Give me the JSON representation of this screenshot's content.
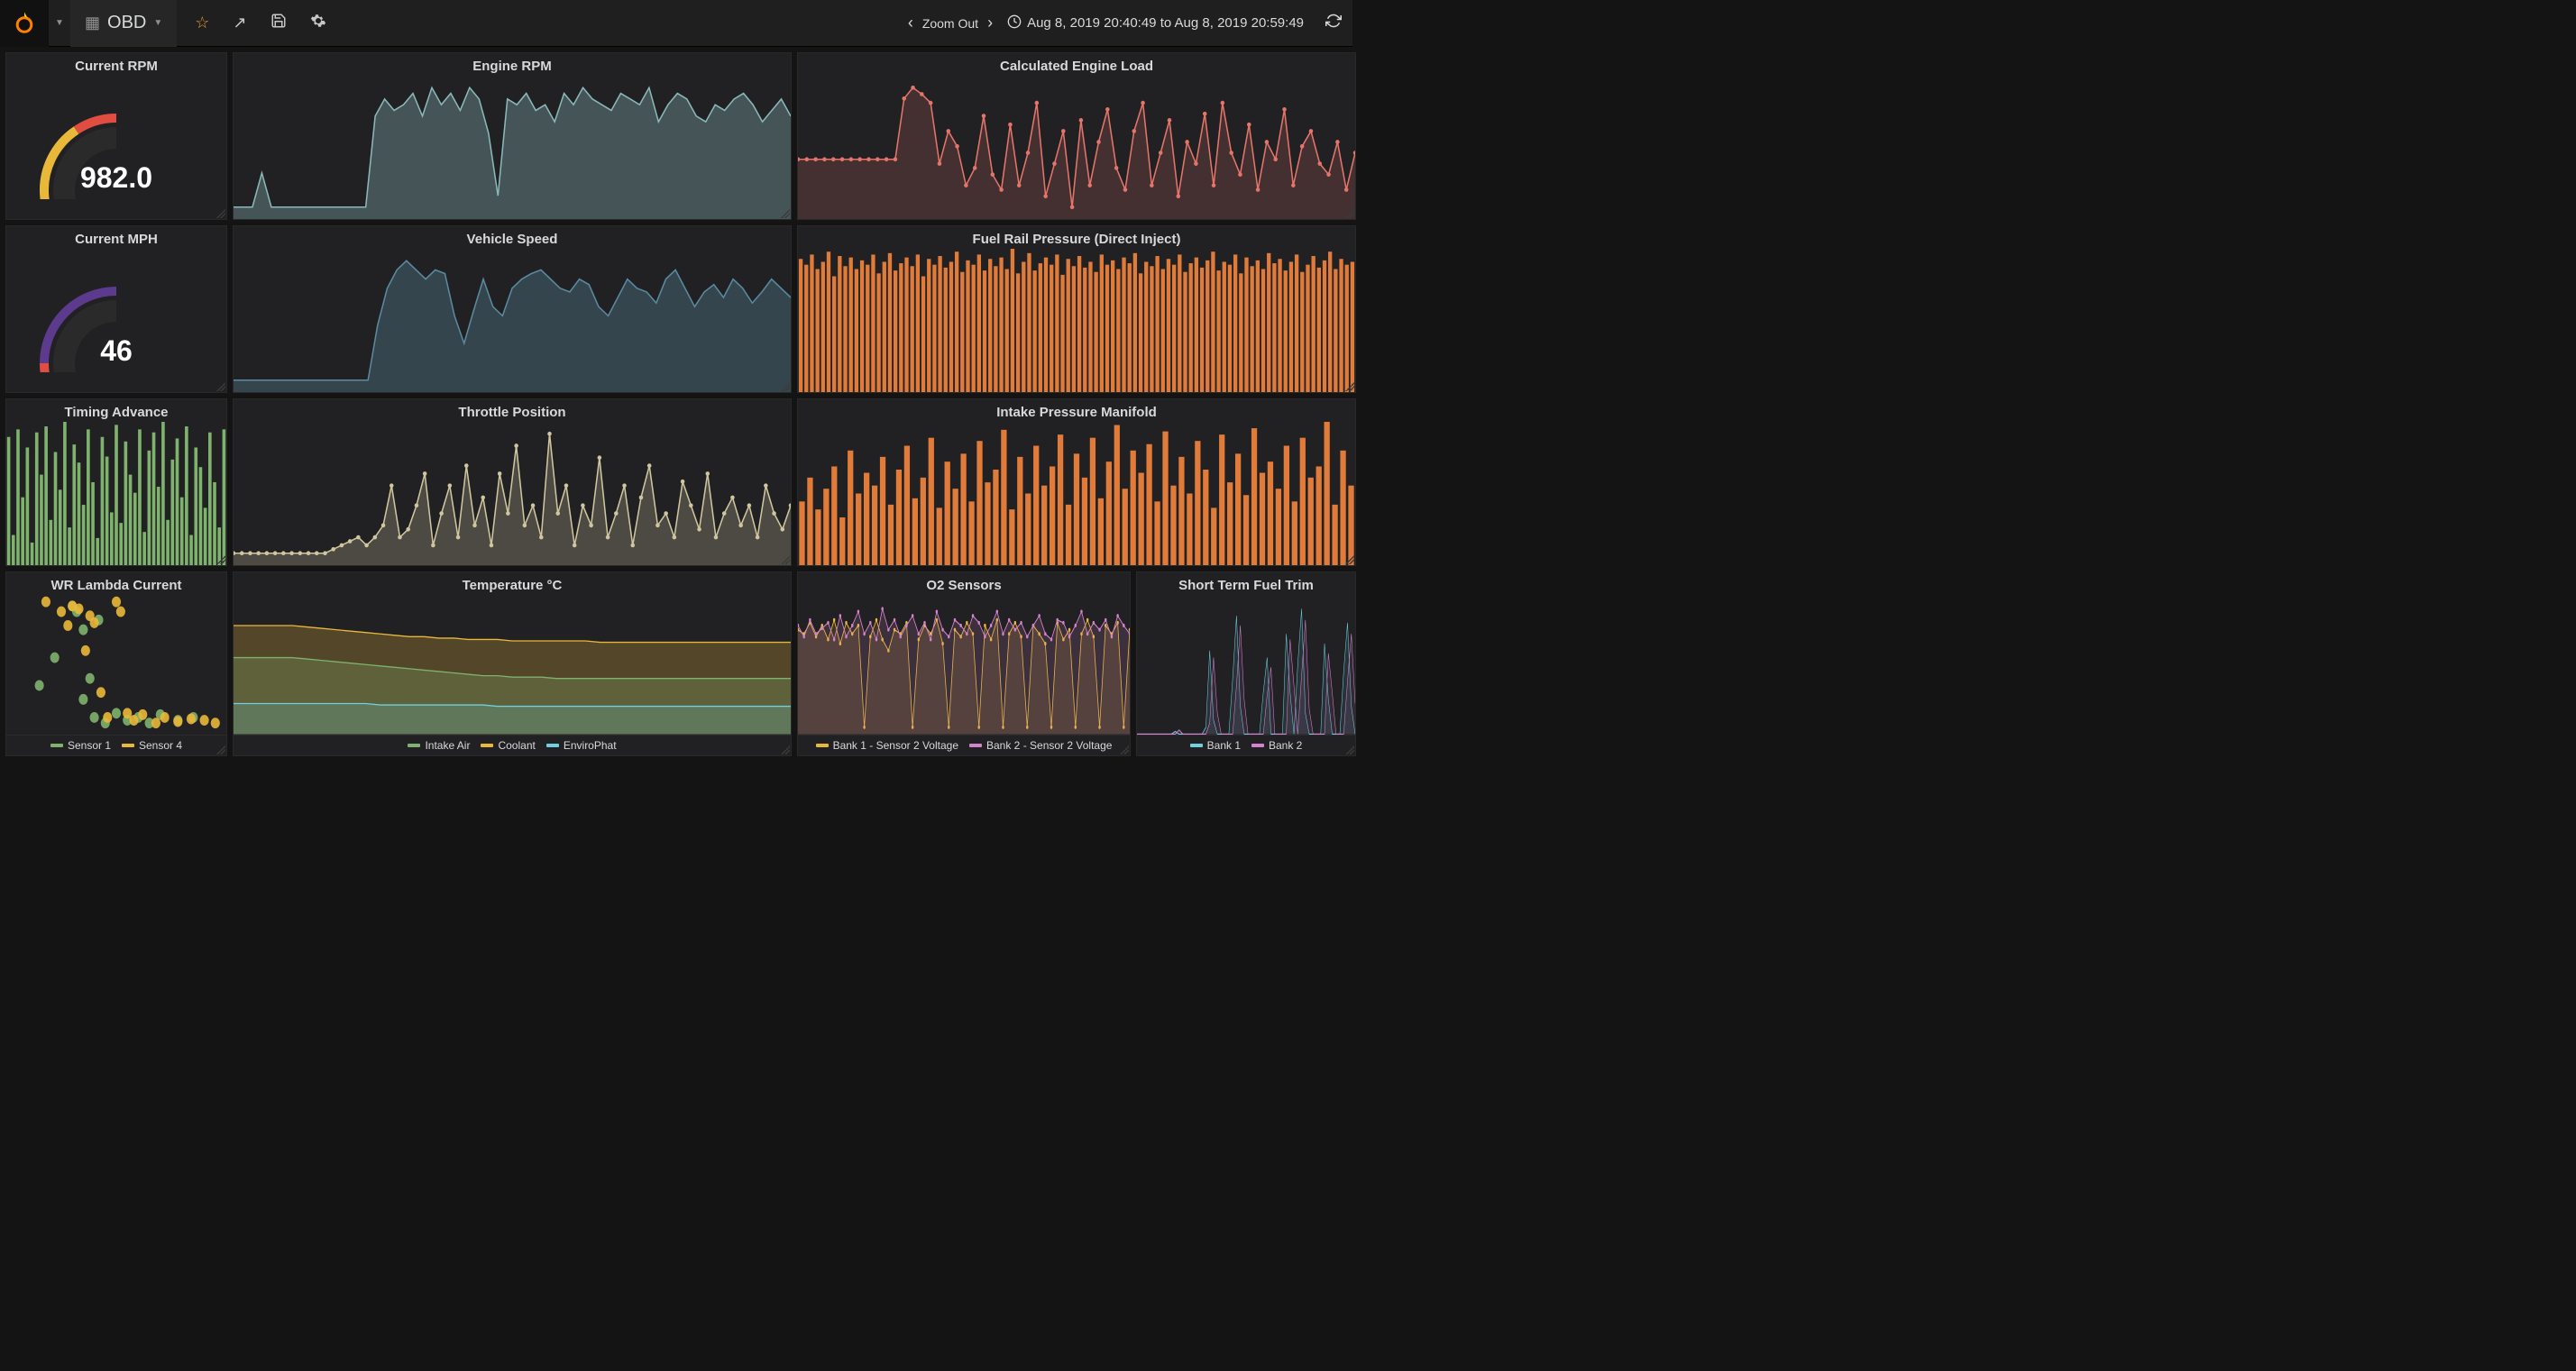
{
  "nav": {
    "dashboard_title": "OBD",
    "zoom_label": "Zoom Out",
    "timerange": "Aug 8, 2019 20:40:49 to Aug 8, 2019 20:59:49"
  },
  "panels": {
    "current_rpm": {
      "title": "Current RPM",
      "value": "982.0"
    },
    "current_mph": {
      "title": "Current MPH",
      "value": "46"
    },
    "engine_rpm": {
      "title": "Engine RPM"
    },
    "engine_load": {
      "title": "Calculated Engine Load"
    },
    "vehicle_speed": {
      "title": "Vehicle Speed"
    },
    "fuel_rail": {
      "title": "Fuel Rail Pressure (Direct Inject)"
    },
    "timing_advance": {
      "title": "Timing Advance"
    },
    "throttle": {
      "title": "Throttle Position"
    },
    "intake_manifold": {
      "title": "Intake Pressure Manifold"
    },
    "lambda": {
      "title": "WR Lambda Current",
      "legend": [
        {
          "label": "Sensor 1",
          "color": "#7eb26d"
        },
        {
          "label": "Sensor 4",
          "color": "#eab839"
        }
      ]
    },
    "temperature": {
      "title": "Temperature °C",
      "legend": [
        {
          "label": "Intake Air",
          "color": "#7eb26d"
        },
        {
          "label": "Coolant",
          "color": "#eab839"
        },
        {
          "label": "EnviroPhat",
          "color": "#6ed0e0"
        }
      ]
    },
    "o2": {
      "title": "O2 Sensors",
      "legend": [
        {
          "label": "Bank 1 - Sensor 2 Voltage",
          "color": "#eab839"
        },
        {
          "label": "Bank 2 - Sensor 2 Voltage",
          "color": "#d683ce"
        }
      ]
    },
    "fuel_trim": {
      "title": "Short Term Fuel Trim",
      "legend": [
        {
          "label": "Bank 1",
          "color": "#6ed0e0"
        },
        {
          "label": "Bank 2",
          "color": "#d683ce"
        }
      ]
    }
  },
  "colors": {
    "teal": "#8ab8b8",
    "green": "#7eb26d",
    "yellow": "#eab839",
    "orange": "#e07b3a",
    "red": "#e24d42",
    "salmon": "#e5756a",
    "steel": "#5a8a9e",
    "tan": "#cfc69f",
    "purple": "#d683ce",
    "cyan": "#6ed0e0"
  },
  "chart_data": [
    {
      "panel": "current_rpm",
      "type": "gauge",
      "value": 982.0,
      "min": 0,
      "max": 8000,
      "thresholds": [
        [
          0,
          "#e24d42"
        ],
        [
          1000,
          "#eab839"
        ],
        [
          6500,
          "#e24d42"
        ]
      ]
    },
    {
      "panel": "current_mph",
      "type": "gauge",
      "value": 46,
      "min": 0,
      "max": 120,
      "thresholds": [
        [
          0,
          "#e24d42"
        ],
        [
          60,
          "#5c3a8e"
        ]
      ]
    },
    {
      "panel": "engine_rpm",
      "type": "area",
      "color": "#8ab8b8",
      "values": [
        800,
        800,
        800,
        1400,
        800,
        800,
        800,
        800,
        800,
        800,
        800,
        800,
        800,
        800,
        800,
        2400,
        2700,
        2500,
        2600,
        2800,
        2400,
        2900,
        2600,
        2800,
        2500,
        2900,
        2700,
        2100,
        1000,
        2700,
        2600,
        2800,
        2500,
        2600,
        2300,
        2800,
        2600,
        2900,
        2700,
        2600,
        2500,
        2800,
        2700,
        2600,
        2900,
        2300,
        2600,
        2800,
        2700,
        2400,
        2300,
        2600,
        2500,
        2700,
        2800,
        2600,
        2300,
        2500,
        2700,
        2400
      ]
    },
    {
      "panel": "engine_load",
      "type": "line",
      "color": "#e5756a",
      "points": true,
      "fill": 0.18,
      "values": [
        42,
        42,
        42,
        42,
        42,
        42,
        42,
        42,
        42,
        42,
        42,
        42,
        70,
        75,
        72,
        68,
        40,
        55,
        48,
        30,
        38,
        62,
        35,
        28,
        58,
        30,
        45,
        68,
        25,
        40,
        55,
        20,
        60,
        30,
        50,
        65,
        38,
        28,
        55,
        68,
        30,
        45,
        60,
        25,
        50,
        40,
        63,
        30,
        68,
        45,
        35,
        58,
        28,
        50,
        42,
        65,
        30,
        48,
        55,
        40,
        35,
        50,
        28,
        45
      ]
    },
    {
      "panel": "vehicle_speed",
      "type": "area",
      "color": "#5a8a9e",
      "values": [
        0,
        0,
        0,
        0,
        0,
        0,
        0,
        0,
        0,
        0,
        0,
        0,
        0,
        0,
        0,
        30,
        50,
        60,
        65,
        60,
        55,
        60,
        58,
        35,
        20,
        38,
        55,
        40,
        35,
        50,
        55,
        58,
        60,
        55,
        50,
        48,
        55,
        52,
        40,
        35,
        45,
        55,
        50,
        48,
        42,
        55,
        60,
        50,
        40,
        48,
        52,
        45,
        55,
        50,
        42,
        48,
        55,
        50,
        45
      ]
    },
    {
      "panel": "fuel_rail",
      "type": "bar",
      "color": "#e07b3a",
      "values": [
        92,
        88,
        95,
        85,
        90,
        97,
        80,
        94,
        87,
        93,
        85,
        91,
        88,
        95,
        82,
        90,
        96,
        84,
        89,
        93,
        87,
        95,
        80,
        92,
        88,
        94,
        86,
        90,
        97,
        83,
        91,
        88,
        95,
        84,
        92,
        87,
        93,
        85,
        99,
        82,
        90,
        96,
        84,
        89,
        93,
        88,
        95,
        81,
        92,
        87,
        94,
        86,
        90,
        83,
        95,
        88,
        91,
        85,
        93,
        89,
        96,
        82,
        90,
        87,
        94,
        85,
        92,
        88,
        95,
        83,
        89,
        93,
        86,
        91,
        97,
        84,
        90,
        88,
        95,
        82,
        93,
        87,
        91,
        85,
        96,
        89,
        92,
        84,
        90,
        95,
        83,
        88,
        94,
        86,
        91,
        97,
        85,
        92,
        88,
        90
      ]
    },
    {
      "panel": "timing_advance",
      "type": "bar",
      "color": "#7eb26d",
      "values": [
        85,
        20,
        90,
        45,
        78,
        15,
        88,
        60,
        92,
        30,
        75,
        50,
        95,
        25,
        80,
        68,
        40,
        90,
        55,
        18,
        85,
        72,
        35,
        93,
        28,
        82,
        60,
        48,
        90,
        22,
        76,
        88,
        52,
        95,
        30,
        70,
        84,
        45,
        92,
        20,
        78,
        65,
        38,
        88,
        55,
        25,
        90
      ]
    },
    {
      "panel": "throttle",
      "type": "line",
      "color": "#cfc69f",
      "points": true,
      "fill": 0.25,
      "values": [
        18,
        18,
        18,
        18,
        18,
        18,
        18,
        18,
        18,
        18,
        18,
        18,
        19,
        20,
        21,
        22,
        20,
        22,
        25,
        35,
        22,
        24,
        30,
        38,
        20,
        28,
        35,
        22,
        40,
        25,
        32,
        20,
        38,
        28,
        45,
        25,
        30,
        22,
        48,
        28,
        35,
        20,
        30,
        25,
        42,
        22,
        28,
        35,
        20,
        32,
        40,
        25,
        28,
        22,
        36,
        30,
        24,
        38,
        22,
        28,
        32,
        25,
        30,
        22,
        35,
        28,
        24,
        30
      ]
    },
    {
      "panel": "intake_manifold",
      "type": "bar",
      "color": "#e07b3a",
      "values": [
        40,
        55,
        35,
        48,
        62,
        30,
        72,
        45,
        58,
        50,
        68,
        38,
        60,
        75,
        42,
        55,
        80,
        36,
        65,
        48,
        70,
        40,
        78,
        52,
        60,
        85,
        35,
        68,
        45,
        75,
        50,
        62,
        82,
        38,
        70,
        55,
        80,
        42,
        65,
        88,
        48,
        72,
        58,
        76,
        40,
        84,
        50,
        68,
        45,
        78,
        60,
        36,
        82,
        52,
        70,
        44,
        86,
        58,
        65,
        48,
        75,
        40,
        80,
        55,
        62,
        90,
        38,
        72,
        50
      ]
    },
    {
      "panel": "lambda",
      "type": "scatter",
      "series": [
        {
          "name": "Sensor 1",
          "color": "#7eb26d",
          "points": [
            [
              0.15,
              0.35
            ],
            [
              0.22,
              0.55
            ],
            [
              0.3,
              0.92
            ],
            [
              0.32,
              0.88
            ],
            [
              0.35,
              0.25
            ],
            [
              0.35,
              0.75
            ],
            [
              0.38,
              0.4
            ],
            [
              0.4,
              0.12
            ],
            [
              0.42,
              0.82
            ],
            [
              0.45,
              0.08
            ],
            [
              0.5,
              0.15
            ],
            [
              0.55,
              0.1
            ],
            [
              0.6,
              0.12
            ],
            [
              0.65,
              0.08
            ],
            [
              0.7,
              0.14
            ],
            [
              0.78,
              0.1
            ],
            [
              0.85,
              0.12
            ]
          ]
        },
        {
          "name": "Sensor 4",
          "color": "#eab839",
          "points": [
            [
              0.18,
              0.95
            ],
            [
              0.25,
              0.88
            ],
            [
              0.28,
              0.78
            ],
            [
              0.3,
              0.92
            ],
            [
              0.33,
              0.9
            ],
            [
              0.36,
              0.6
            ],
            [
              0.38,
              0.85
            ],
            [
              0.4,
              0.8
            ],
            [
              0.43,
              0.3
            ],
            [
              0.46,
              0.12
            ],
            [
              0.5,
              0.95
            ],
            [
              0.52,
              0.88
            ],
            [
              0.55,
              0.15
            ],
            [
              0.58,
              0.1
            ],
            [
              0.62,
              0.14
            ],
            [
              0.68,
              0.08
            ],
            [
              0.72,
              0.12
            ],
            [
              0.78,
              0.09
            ],
            [
              0.84,
              0.11
            ],
            [
              0.9,
              0.1
            ],
            [
              0.95,
              0.08
            ]
          ]
        }
      ]
    },
    {
      "panel": "temperature",
      "type": "area",
      "series": [
        {
          "name": "Coolant",
          "color": "#eab839",
          "fill": 0.25,
          "values": [
            78,
            78,
            78,
            78,
            78,
            77,
            76,
            75,
            74,
            73,
            72,
            71,
            70,
            70,
            69,
            69,
            68,
            68,
            68,
            67,
            67,
            67,
            67,
            67,
            67,
            66,
            66,
            66,
            66,
            66,
            66,
            66,
            66,
            66,
            66,
            66,
            66,
            66,
            66
          ]
        },
        {
          "name": "Intake Air",
          "color": "#7eb26d",
          "fill": 0.25,
          "values": [
            55,
            55,
            55,
            55,
            55,
            54,
            53,
            52,
            51,
            50,
            49,
            48,
            47,
            46,
            45,
            44,
            43,
            42,
            42,
            41,
            41,
            41,
            40,
            40,
            40,
            40,
            40,
            40,
            40,
            40,
            40,
            40,
            40,
            40,
            40,
            40,
            40,
            40,
            40
          ]
        },
        {
          "name": "EnviroPhat",
          "color": "#6ed0e0",
          "fill": 0.2,
          "values": [
            22,
            22,
            22,
            22,
            22,
            22,
            22,
            22,
            22,
            22,
            21,
            21,
            21,
            21,
            21,
            21,
            21,
            21,
            20,
            20,
            20,
            20,
            20,
            20,
            20,
            20,
            20,
            20,
            20,
            20,
            20,
            20,
            20,
            20,
            20,
            20,
            20,
            20,
            20
          ]
        }
      ],
      "ylim": [
        0,
        100
      ]
    },
    {
      "panel": "o2",
      "type": "line",
      "points": true,
      "fill": 0.15,
      "series": [
        {
          "name": "Bank 1 - Sensor 2 Voltage",
          "color": "#eab839",
          "values": [
            0.75,
            0.72,
            0.8,
            0.7,
            0.78,
            0.68,
            0.82,
            0.65,
            0.8,
            0.72,
            0.78,
            0.05,
            0.7,
            0.82,
            0.68,
            0.6,
            0.75,
            0.72,
            0.8,
            0.05,
            0.68,
            0.78,
            0.72,
            0.82,
            0.65,
            0.05,
            0.75,
            0.7,
            0.8,
            0.72,
            0.05,
            0.78,
            0.68,
            0.82,
            0.05,
            0.72,
            0.8,
            0.7,
            0.05,
            0.78,
            0.72,
            0.65,
            0.05,
            0.8,
            0.68,
            0.75,
            0.05,
            0.72,
            0.82,
            0.7,
            0.05,
            0.78,
            0.72,
            0.8,
            0.05,
            0.75
          ]
        },
        {
          "name": "Bank 2 - Sensor 2 Voltage",
          "color": "#d683ce",
          "values": [
            0.78,
            0.7,
            0.82,
            0.72,
            0.76,
            0.8,
            0.68,
            0.85,
            0.7,
            0.78,
            0.88,
            0.72,
            0.8,
            0.68,
            0.9,
            0.75,
            0.82,
            0.7,
            0.78,
            0.85,
            0.72,
            0.8,
            0.68,
            0.88,
            0.75,
            0.7,
            0.82,
            0.78,
            0.72,
            0.85,
            0.8,
            0.7,
            0.78,
            0.88,
            0.72,
            0.82,
            0.75,
            0.8,
            0.7,
            0.78,
            0.85,
            0.72,
            0.68,
            0.82,
            0.8,
            0.7,
            0.78,
            0.88,
            0.72,
            0.8,
            0.75,
            0.82,
            0.7,
            0.85,
            0.78,
            0.72
          ]
        }
      ],
      "ylim": [
        0,
        1
      ]
    },
    {
      "panel": "fuel_trim",
      "type": "line",
      "fill": 0.1,
      "series": [
        {
          "name": "Bank 1",
          "color": "#6ed0e0",
          "values": [
            0,
            0,
            0,
            0,
            0,
            0,
            0,
            0,
            0,
            0,
            2,
            0,
            0,
            0,
            0,
            0,
            0,
            0,
            5,
            60,
            10,
            0,
            0,
            0,
            0,
            40,
            85,
            20,
            0,
            0,
            0,
            0,
            0,
            30,
            55,
            0,
            0,
            0,
            0,
            72,
            30,
            0,
            50,
            90,
            15,
            0,
            0,
            0,
            0,
            65,
            25,
            0,
            0,
            0,
            45,
            80,
            20,
            0
          ]
        },
        {
          "name": "Bank 2",
          "color": "#d683ce",
          "values": [
            0,
            0,
            0,
            0,
            0,
            0,
            0,
            0,
            0,
            0,
            0,
            3,
            0,
            0,
            0,
            0,
            0,
            0,
            0,
            8,
            55,
            15,
            0,
            0,
            0,
            0,
            35,
            78,
            25,
            0,
            0,
            0,
            0,
            0,
            28,
            48,
            0,
            0,
            0,
            0,
            68,
            35,
            0,
            42,
            82,
            18,
            0,
            0,
            0,
            0,
            58,
            30,
            0,
            0,
            0,
            38,
            72,
            22
          ]
        }
      ],
      "ylim": [
        0,
        100
      ]
    }
  ]
}
